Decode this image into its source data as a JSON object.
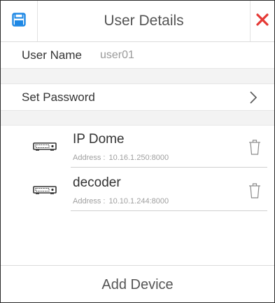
{
  "header": {
    "title": "User Details",
    "save_icon": "save-icon",
    "close_icon": "close-icon",
    "accent_color": "#1e88e5",
    "close_color": "#e53935"
  },
  "user": {
    "label": "User Name",
    "value": "user01"
  },
  "password": {
    "label": "Set Password",
    "chevron_icon": "chevron-right-icon"
  },
  "devices": [
    {
      "name": "IP Dome",
      "address_label": "Address :",
      "address": "10.16.1.250:8000",
      "icon": "device-icon",
      "delete_icon": "trash-icon"
    },
    {
      "name": "decoder",
      "address_label": "Address :",
      "address": "10.10.1.244:8000",
      "icon": "device-icon",
      "delete_icon": "trash-icon"
    }
  ],
  "footer": {
    "add_device_label": "Add Device"
  }
}
